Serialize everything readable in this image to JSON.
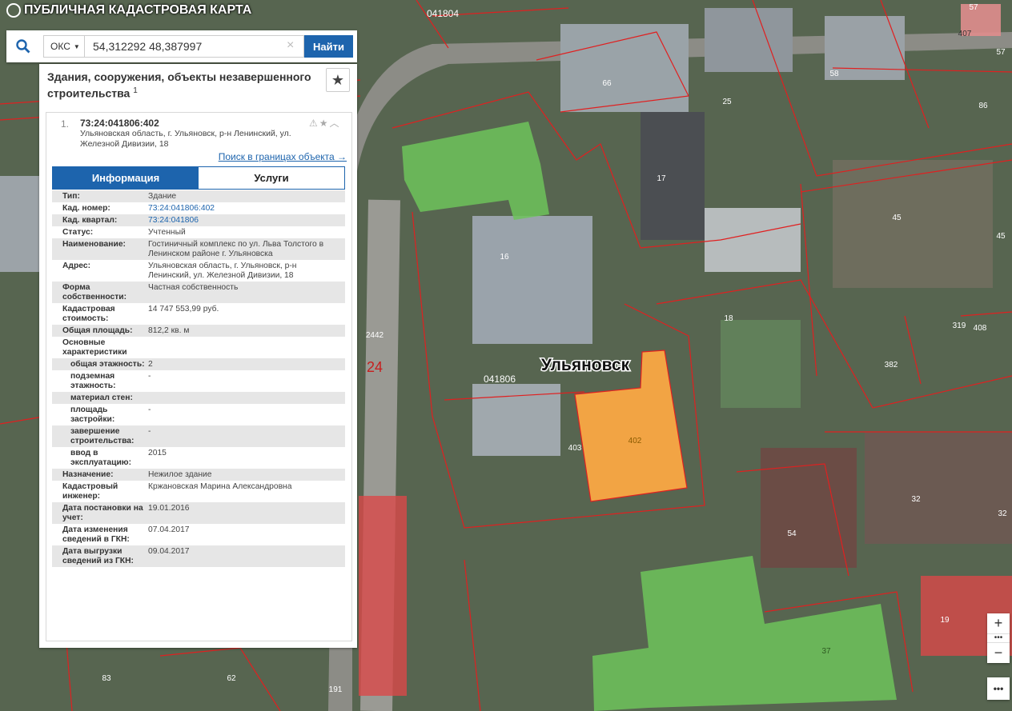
{
  "app": {
    "title": "ПУБЛИЧНАЯ КАДАСТРОВАЯ КАРТА"
  },
  "search": {
    "type": "ОКС",
    "query": "54,312292 48,387997",
    "button": "Найти"
  },
  "panel": {
    "header": "Здания, сооружения, объекты незавершенного строительства",
    "header_sup": "1",
    "card": {
      "num": "1.",
      "kad_number": "73:24:041806:402",
      "address": "Ульяновская область, г. Ульяновск, р-н Ленинский, ул. Железной Дивизии, 18",
      "bounds_link": "Поиск в границах объекта →",
      "tabs": [
        "Информация",
        "Услуги"
      ],
      "rows": [
        {
          "k": "Тип:",
          "v": "Здание"
        },
        {
          "k": "Кад. номер:",
          "v": "73:24:041806:402",
          "link": true
        },
        {
          "k": "Кад. квартал:",
          "v": "73:24:041806",
          "link": true
        },
        {
          "k": "Статус:",
          "v": "Учтенный"
        },
        {
          "k": "Наименование:",
          "v": "Гостиничный комплекс по ул. Льва Толстого в Ленинском районе г. Ульяновска"
        },
        {
          "k": "Адрес:",
          "v": "Ульяновская область, г. Ульяновск, р-н Ленинский, ул. Железной Дивизии, 18"
        },
        {
          "k": "Форма собственности:",
          "v": "Частная собственность"
        },
        {
          "k": "Кадастровая стоимость:",
          "v": "14 747 553,99 руб."
        },
        {
          "k": "Общая площадь:",
          "v": "812,2 кв. м"
        },
        {
          "k": "Основные характеристики",
          "v": ""
        },
        {
          "k": "общая этажность:",
          "v": "2",
          "sub": true
        },
        {
          "k": "подземная этажность:",
          "v": "-",
          "sub": true
        },
        {
          "k": "материал стен:",
          "v": "",
          "sub": true
        },
        {
          "k": "площадь застройки:",
          "v": "-",
          "sub": true
        },
        {
          "k": "завершение строительства:",
          "v": "-",
          "sub": true
        },
        {
          "k": "ввод в эксплуатацию:",
          "v": "2015",
          "sub": true
        },
        {
          "k": "Назначение:",
          "v": "Нежилое здание"
        },
        {
          "k": "Кадастровый инженер:",
          "v": "Кржановская Марина Александровна"
        },
        {
          "k": "Дата постановки на учет:",
          "v": "19.01.2016"
        },
        {
          "k": "Дата изменения сведений в ГКН:",
          "v": "07.04.2017"
        },
        {
          "k": "Дата выгрузки сведений из ГКН:",
          "v": "09.04.2017"
        }
      ]
    }
  },
  "map": {
    "city_label": "Ульяновск",
    "quarter_labels": [
      "041804",
      "041806"
    ],
    "district_label": "24",
    "parcel_labels": [
      "57",
      "407",
      "57",
      "66",
      "58",
      "25",
      "86",
      "17",
      "45",
      "45",
      "16",
      "18",
      "319",
      "408",
      "382",
      "2442",
      "403",
      "402",
      "32",
      "32",
      "54",
      "19",
      "37",
      "83",
      "62",
      "191"
    ],
    "colors": {
      "highlight": "#f2a444",
      "green": "#6dc35a",
      "red_bldg": "#d94848",
      "boundary": "#e02020"
    }
  },
  "zoom": {
    "in": "+",
    "mid": "•••",
    "out": "−",
    "more": "•••"
  }
}
